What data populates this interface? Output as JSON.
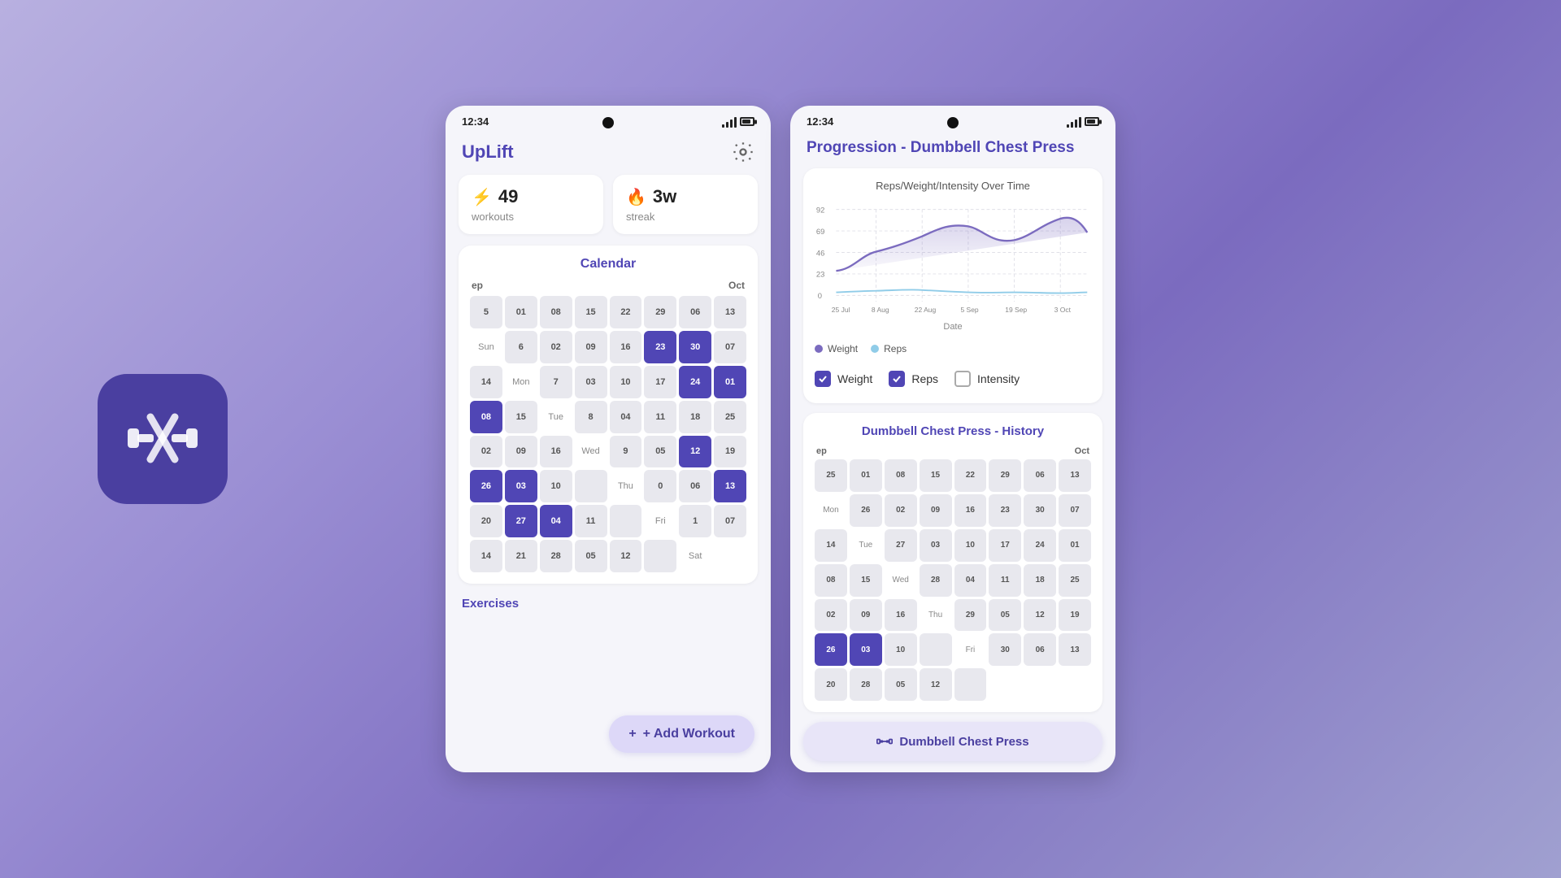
{
  "app": {
    "icon_label": "UpLift App Icon"
  },
  "left_screen": {
    "status_bar": {
      "time": "12:34"
    },
    "header": {
      "title": "UpLift",
      "settings_label": "Settings"
    },
    "stats": {
      "workouts_value": "49",
      "workouts_label": "workouts",
      "streak_value": "3w",
      "streak_label": "streak"
    },
    "calendar": {
      "title": "Calendar",
      "month_left": "ep",
      "month_right": "Oct",
      "rows": [
        {
          "cells": [
            "5",
            "01",
            "08",
            "15",
            "22",
            "29",
            "06",
            "13"
          ],
          "active": [
            false,
            false,
            false,
            false,
            false,
            false,
            false,
            false
          ],
          "day_label": "Sun"
        },
        {
          "cells": [
            "6",
            "02",
            "09",
            "16",
            "23",
            "30",
            "07",
            "14"
          ],
          "active": [
            false,
            false,
            false,
            false,
            true,
            true,
            false,
            false
          ],
          "day_label": "Mon"
        },
        {
          "cells": [
            "7",
            "03",
            "10",
            "17",
            "24",
            "01",
            "08",
            "15"
          ],
          "active": [
            false,
            false,
            false,
            false,
            true,
            true,
            true,
            false
          ],
          "day_label": "Tue"
        },
        {
          "cells": [
            "8",
            "04",
            "11",
            "18",
            "25",
            "02",
            "09",
            "16"
          ],
          "active": [
            false,
            false,
            false,
            false,
            false,
            false,
            false,
            false
          ],
          "day_label": "Wed"
        },
        {
          "cells": [
            "9",
            "05",
            "12",
            "19",
            "26",
            "03",
            "10",
            ""
          ],
          "active": [
            false,
            false,
            true,
            false,
            true,
            true,
            false,
            false
          ],
          "day_label": "Thu"
        },
        {
          "cells": [
            "0",
            "06",
            "13",
            "20",
            "27",
            "04",
            "11",
            ""
          ],
          "active": [
            false,
            false,
            true,
            false,
            true,
            true,
            false,
            false
          ],
          "day_label": "Fri"
        },
        {
          "cells": [
            "1",
            "07",
            "14",
            "21",
            "28",
            "05",
            "12",
            ""
          ],
          "active": [
            false,
            false,
            false,
            false,
            false,
            false,
            false,
            false
          ],
          "day_label": "Sat"
        }
      ]
    },
    "exercises_label": "Exercises",
    "add_workout_btn": "+ Add Workout"
  },
  "right_screen": {
    "status_bar": {
      "time": "12:34"
    },
    "progression_title": "Progression - Dumbbell Chest Press",
    "chart": {
      "title": "Reps/Weight/Intensity Over Time",
      "x_labels": [
        "25 Jul",
        "8 Aug",
        "22 Aug",
        "5 Sep",
        "19 Sep",
        "3 Oct"
      ],
      "y_labels": [
        "92",
        "69",
        "46",
        "23",
        "0"
      ],
      "axis_label": "Date",
      "legend": {
        "weight_label": "Weight",
        "reps_label": "Reps"
      }
    },
    "checkboxes": {
      "weight": {
        "label": "Weight",
        "checked": true
      },
      "reps": {
        "label": "Reps",
        "checked": true
      },
      "intensity": {
        "label": "Intensity",
        "checked": false
      }
    },
    "history": {
      "title": "Dumbbell Chest Press - History",
      "month_left": "ep",
      "month_right": "Oct",
      "rows": [
        {
          "cells": [
            "25",
            "01",
            "08",
            "15",
            "22",
            "29",
            "06",
            "13"
          ],
          "active": [
            false,
            false,
            false,
            false,
            false,
            false,
            false,
            false
          ],
          "day_label": "Mon"
        },
        {
          "cells": [
            "26",
            "02",
            "09",
            "16",
            "23",
            "30",
            "07",
            "14"
          ],
          "active": [
            false,
            false,
            false,
            false,
            false,
            false,
            false,
            false
          ],
          "day_label": "Tue"
        },
        {
          "cells": [
            "27",
            "03",
            "10",
            "17",
            "24",
            "01",
            "08",
            "15"
          ],
          "active": [
            false,
            false,
            false,
            false,
            false,
            false,
            false,
            false
          ],
          "day_label": "Wed"
        },
        {
          "cells": [
            "28",
            "04",
            "11",
            "18",
            "25",
            "02",
            "09",
            "16"
          ],
          "active": [
            false,
            false,
            false,
            false,
            false,
            false,
            false,
            false
          ],
          "day_label": "Thu"
        },
        {
          "cells": [
            "29",
            "05",
            "12",
            "19",
            "26",
            "03",
            "10",
            ""
          ],
          "active": [
            false,
            false,
            false,
            false,
            true,
            true,
            false,
            false
          ],
          "day_label": "Fri"
        },
        {
          "cells": [
            "30",
            "06",
            "13",
            "20",
            "28",
            "05",
            "12",
            ""
          ],
          "active": [
            false,
            false,
            false,
            false,
            false,
            false,
            false,
            false
          ],
          "day_label": ""
        }
      ]
    },
    "dumbbell_btn": "Dumbbell Chest Press"
  },
  "colors": {
    "primary": "#5046b5",
    "active_cell": "#5046b5",
    "inactive_cell": "#e2e1eb",
    "background": "#9b8fd4"
  }
}
